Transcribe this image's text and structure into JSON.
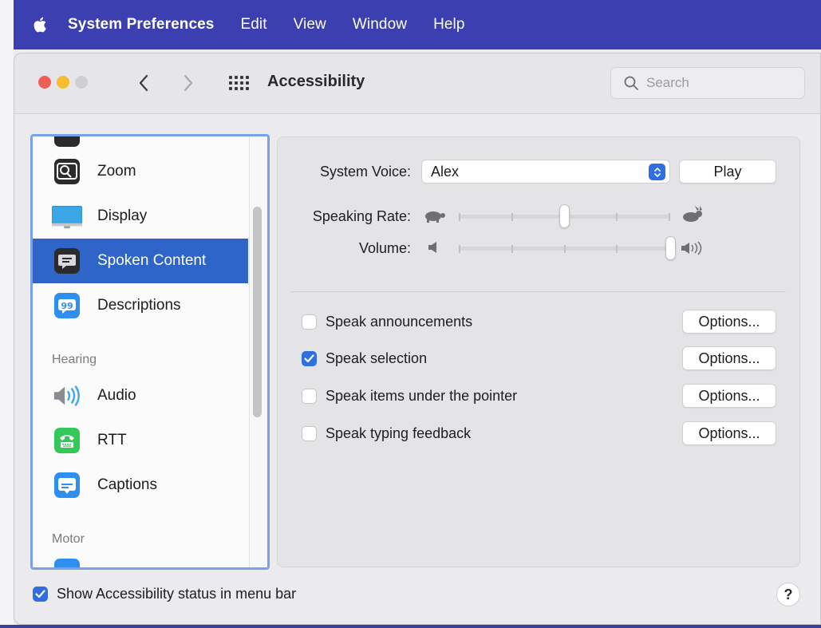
{
  "menubar": {
    "apple_icon": "apple-logo-icon",
    "items": [
      {
        "label": "System Preferences"
      },
      {
        "label": "Edit"
      },
      {
        "label": "View"
      },
      {
        "label": "Window"
      },
      {
        "label": "Help"
      }
    ]
  },
  "window": {
    "title": "Accessibility",
    "search_placeholder": "Search",
    "traffic_lights": {
      "close": "#ed5e57",
      "minimize": "#f5bd2f",
      "zoom": "#cfcfd2"
    }
  },
  "sidebar": {
    "items": [
      {
        "label": "Zoom",
        "icon": "zoom-icon",
        "selected": false
      },
      {
        "label": "Display",
        "icon": "display-icon",
        "selected": false
      },
      {
        "label": "Spoken Content",
        "icon": "spoken-content-icon",
        "selected": true
      },
      {
        "label": "Descriptions",
        "icon": "descriptions-icon",
        "selected": false
      },
      {
        "label": "Audio",
        "icon": "audio-icon",
        "selected": false
      },
      {
        "label": "RTT",
        "icon": "rtt-icon",
        "selected": false
      },
      {
        "label": "Captions",
        "icon": "captions-icon",
        "selected": false
      }
    ],
    "sections": {
      "hearing": "Hearing",
      "motor": "Motor"
    },
    "accent": "#2f64c8"
  },
  "panel": {
    "system_voice": {
      "label": "System Voice:",
      "value": "Alex",
      "play": "Play"
    },
    "speaking_rate": {
      "label": "Speaking Rate:",
      "value": 0.5
    },
    "volume": {
      "label": "Volume:",
      "value": 1.0
    },
    "options": [
      {
        "label": "Speak announcements",
        "checked": false,
        "button": "Options..."
      },
      {
        "label": "Speak selection",
        "checked": true,
        "button": "Options..."
      },
      {
        "label": "Speak items under the pointer",
        "checked": false,
        "button": "Options..."
      },
      {
        "label": "Speak typing feedback",
        "checked": false,
        "button": "Options..."
      }
    ]
  },
  "footer": {
    "status_checkbox": {
      "label": "Show Accessibility status in menu bar",
      "checked": true
    },
    "help": "?"
  }
}
